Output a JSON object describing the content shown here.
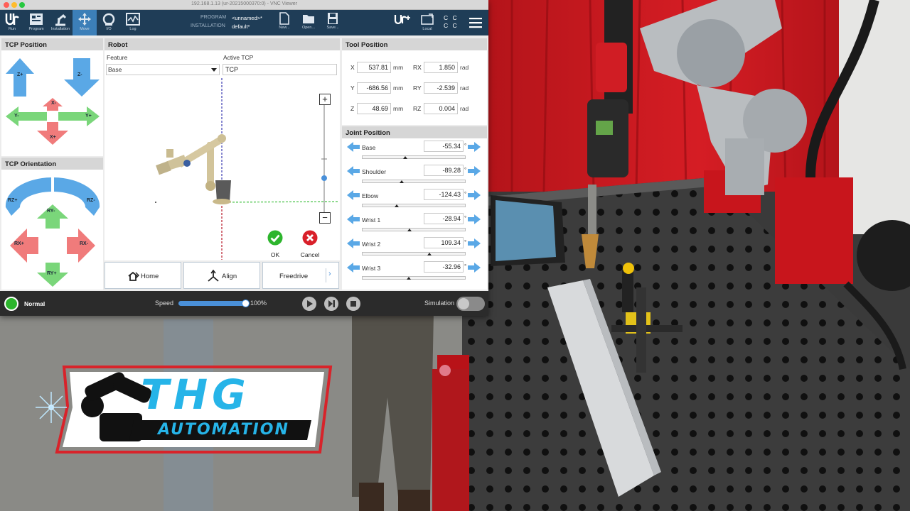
{
  "window": {
    "title": "192.168.1.13 (ur-20215000370:0) - VNC Viewer"
  },
  "toolbar": {
    "nav": [
      {
        "label": "Run",
        "icon": "ur-logo-icon"
      },
      {
        "label": "Program",
        "icon": "program-icon"
      },
      {
        "label": "Installation",
        "icon": "installation-icon"
      },
      {
        "label": "Move",
        "icon": "move-icon",
        "active": true
      },
      {
        "label": "I/O",
        "icon": "io-icon"
      },
      {
        "label": "Log",
        "icon": "log-icon"
      }
    ],
    "program_label": "PROGRAM",
    "program_value": "<unnamed>*",
    "installation_label": "INSTALLATION",
    "installation_value": "default*",
    "file_buttons": [
      {
        "label": "New...",
        "icon": "new-file-icon"
      },
      {
        "label": "Open...",
        "icon": "open-folder-icon"
      },
      {
        "label": "Save...",
        "icon": "save-icon"
      }
    ],
    "local_label": "Local",
    "cc_text": "C C\nC C"
  },
  "tcp_position": {
    "title": "TCP Position",
    "labels": {
      "zplus": "Z+",
      "zminus": "Z-",
      "xminus": "X-",
      "yminus": "Y-",
      "yplus": "Y+",
      "xplus": "X+"
    }
  },
  "tcp_orientation": {
    "title": "TCP Orientation",
    "labels": {
      "rzplus": "RZ+",
      "rzminus": "RZ-",
      "ryminus": "RY-",
      "rxplus": "RX+",
      "rxminus": "RX-",
      "ryplus": "RY+"
    }
  },
  "robot": {
    "title": "Robot",
    "feature_label": "Feature",
    "feature_value": "Base",
    "active_tcp_label": "Active TCP",
    "active_tcp_value": "TCP",
    "zoom_in": "+",
    "zoom_out": "−",
    "ok_label": "OK",
    "cancel_label": "Cancel",
    "home_label": "Home",
    "align_label": "Align",
    "freedrive_label": "Freedrive"
  },
  "tool_position": {
    "title": "Tool Position",
    "rows": [
      {
        "axis": "X",
        "value": "537.81",
        "unit": "mm",
        "raxis": "RX",
        "rvalue": "1.850",
        "runit": "rad"
      },
      {
        "axis": "Y",
        "value": "-686.56",
        "unit": "mm",
        "raxis": "RY",
        "rvalue": "-2.539",
        "runit": "rad"
      },
      {
        "axis": "Z",
        "value": "48.69",
        "unit": "mm",
        "raxis": "RZ",
        "rvalue": "0.004",
        "runit": "rad"
      }
    ]
  },
  "joint_position": {
    "title": "Joint Position",
    "unit": "°",
    "joints": [
      {
        "name": "Base",
        "value": "-55.34",
        "level": 0.42
      },
      {
        "name": "Shoulder",
        "value": "-89.28",
        "level": 0.38
      },
      {
        "name": "Elbow",
        "value": "-124.43",
        "level": 0.33
      },
      {
        "name": "Wrist 1",
        "value": "-28.94",
        "level": 0.46
      },
      {
        "name": "Wrist 2",
        "value": "109.34",
        "level": 0.65
      },
      {
        "name": "Wrist 3",
        "value": "-32.96",
        "level": 0.45
      }
    ]
  },
  "status": {
    "state": "Normal",
    "speed_label": "Speed",
    "speed_value": "100%",
    "speed_level": 1.0,
    "simulation_label": "Simulation"
  },
  "logo": {
    "line1": "THG",
    "line2": "AUTOMATION"
  },
  "colors": {
    "toolbar": "#1f3d57",
    "active_tab": "#3c7fb8",
    "arrow_blue": "#5aa8e6",
    "arrow_green": "#7ad67a",
    "arrow_red": "#f07b7b",
    "ok_green": "#2db52d",
    "cancel_red": "#d9202a",
    "logo_cyan": "#26b4e8",
    "logo_red": "#d8232a"
  }
}
